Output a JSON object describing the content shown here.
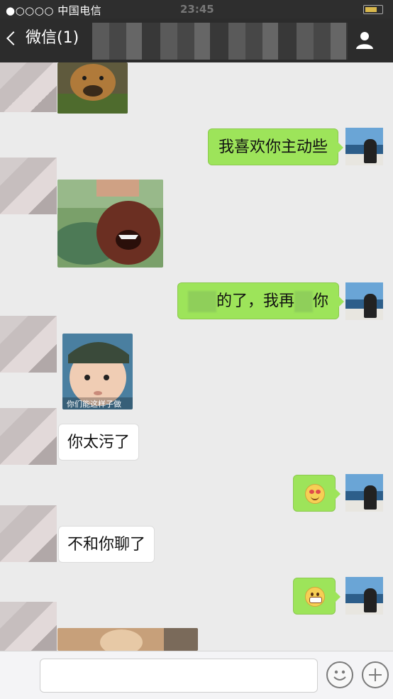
{
  "status_bar": {
    "carrier": "●○○○○ 中国电信",
    "time": "23:45"
  },
  "nav": {
    "back_label": "微信(1)"
  },
  "messages": [
    {
      "side": "in",
      "kind": "image",
      "desc": "dog"
    },
    {
      "side": "out",
      "kind": "text",
      "text": "我喜欢你主动些"
    },
    {
      "side": "in",
      "kind": "image",
      "desc": "dog-bite"
    },
    {
      "side": "out",
      "kind": "text",
      "text_a": "的了，我再",
      "text_b": "你"
    },
    {
      "side": "in",
      "kind": "image",
      "desc": "baby",
      "caption": "你们能这样子做"
    },
    {
      "side": "in",
      "kind": "text",
      "text": "你太污了"
    },
    {
      "side": "out",
      "kind": "emoji",
      "emoji": "heart-eyes"
    },
    {
      "side": "in",
      "kind": "text",
      "text": "不和你聊了"
    },
    {
      "side": "out",
      "kind": "emoji",
      "emoji": "grin"
    }
  ],
  "colors": {
    "outgoing_bubble": "#9de45a",
    "incoming_bubble": "#ffffff",
    "nav_bg": "#2c2c2c",
    "chat_bg": "#ebebeb"
  }
}
